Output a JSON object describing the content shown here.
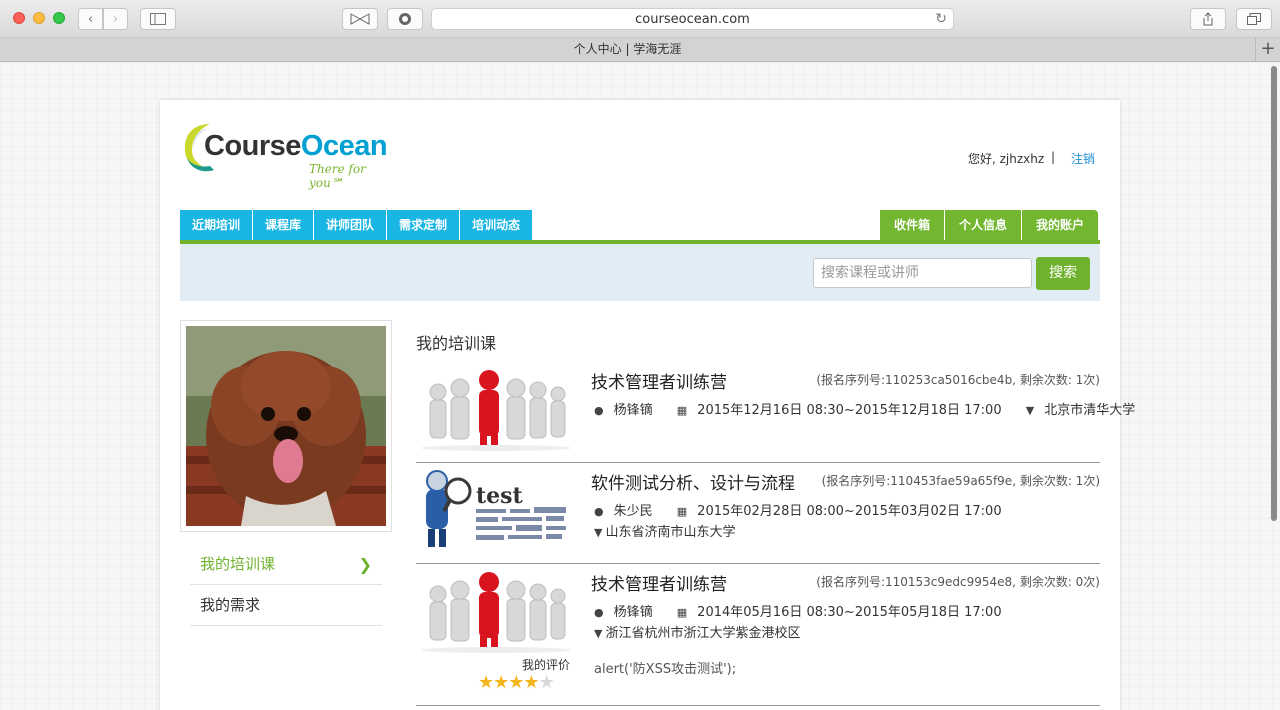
{
  "browser": {
    "url": "courseocean.com",
    "tab_title": "个人中心 | 学海无涯",
    "new_tab": "+"
  },
  "header": {
    "logo_course": "Course",
    "logo_ocean": "Ocean",
    "logo_tagline": "There for you℠",
    "greeting": "您好, zjhzxhz",
    "separator": "|",
    "logout": "注销"
  },
  "nav_left": [
    "近期培训",
    "课程库",
    "讲师团队",
    "需求定制",
    "培训动态"
  ],
  "nav_right": [
    "收件箱",
    "个人信息",
    "我的账户"
  ],
  "search": {
    "placeholder": "搜索课程或讲师",
    "button": "搜索"
  },
  "sidebar": {
    "items": [
      {
        "label": "我的培训课",
        "active": true
      },
      {
        "label": "我的需求",
        "active": false
      }
    ]
  },
  "main": {
    "title": "我的培训课",
    "courses": [
      {
        "title": "技术管理者训练营",
        "serial": "(报名序列号:110253ca5016cbe4b, 剩余次数: 1次)",
        "teacher": "杨锋镝",
        "time": "2015年12月16日 08:30~2015年12月18日 17:00",
        "location": "北京市清华大学"
      },
      {
        "title": "软件测试分析、设计与流程",
        "serial": "(报名序列号:110453fae59a65f9e, 剩余次数: 1次)",
        "teacher": "朱少民",
        "time": "2015年02月28日 08:00~2015年03月02日 17:00",
        "location": "山东省济南市山东大学"
      },
      {
        "title": "技术管理者训练营",
        "serial": "(报名序列号:110153c9edc9954e8, 剩余次数: 0次)",
        "teacher": "杨锋镝",
        "time": "2014年05月16日 08:30~2015年05月18日 17:00",
        "location": "浙江省杭州市浙江大学紫金港校区",
        "rating_label": "我的评价",
        "rating": 4,
        "rating_max": 5,
        "comment": "alert('防XSS攻击测试');"
      }
    ]
  },
  "colors": {
    "nav_blue": "#19b5e3",
    "nav_green": "#72b72f",
    "link_blue": "#1c8fd6",
    "search_bg": "#e1ecf5"
  }
}
